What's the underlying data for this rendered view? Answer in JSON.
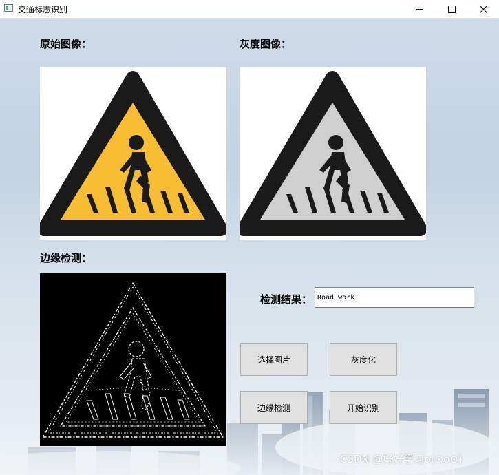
{
  "window": {
    "title": "交通标志识别"
  },
  "labels": {
    "original": "原始图像：",
    "gray": "灰度图像：",
    "edge": "边缘检测：",
    "result": "检测结果："
  },
  "result": {
    "value": "Road work"
  },
  "buttons": {
    "select_image": "选择图片",
    "grayscale": "灰度化",
    "edge_detect": "边缘检测",
    "start_recognize": "开始识别"
  },
  "watermark": "CSDN @好好学习o(⊙o⊙)",
  "colors": {
    "sign_yellow": "#f7bd33",
    "sign_gray": "#cfcfcf",
    "sign_black": "#1a1a1a",
    "button_face": "#e1e1e1"
  }
}
